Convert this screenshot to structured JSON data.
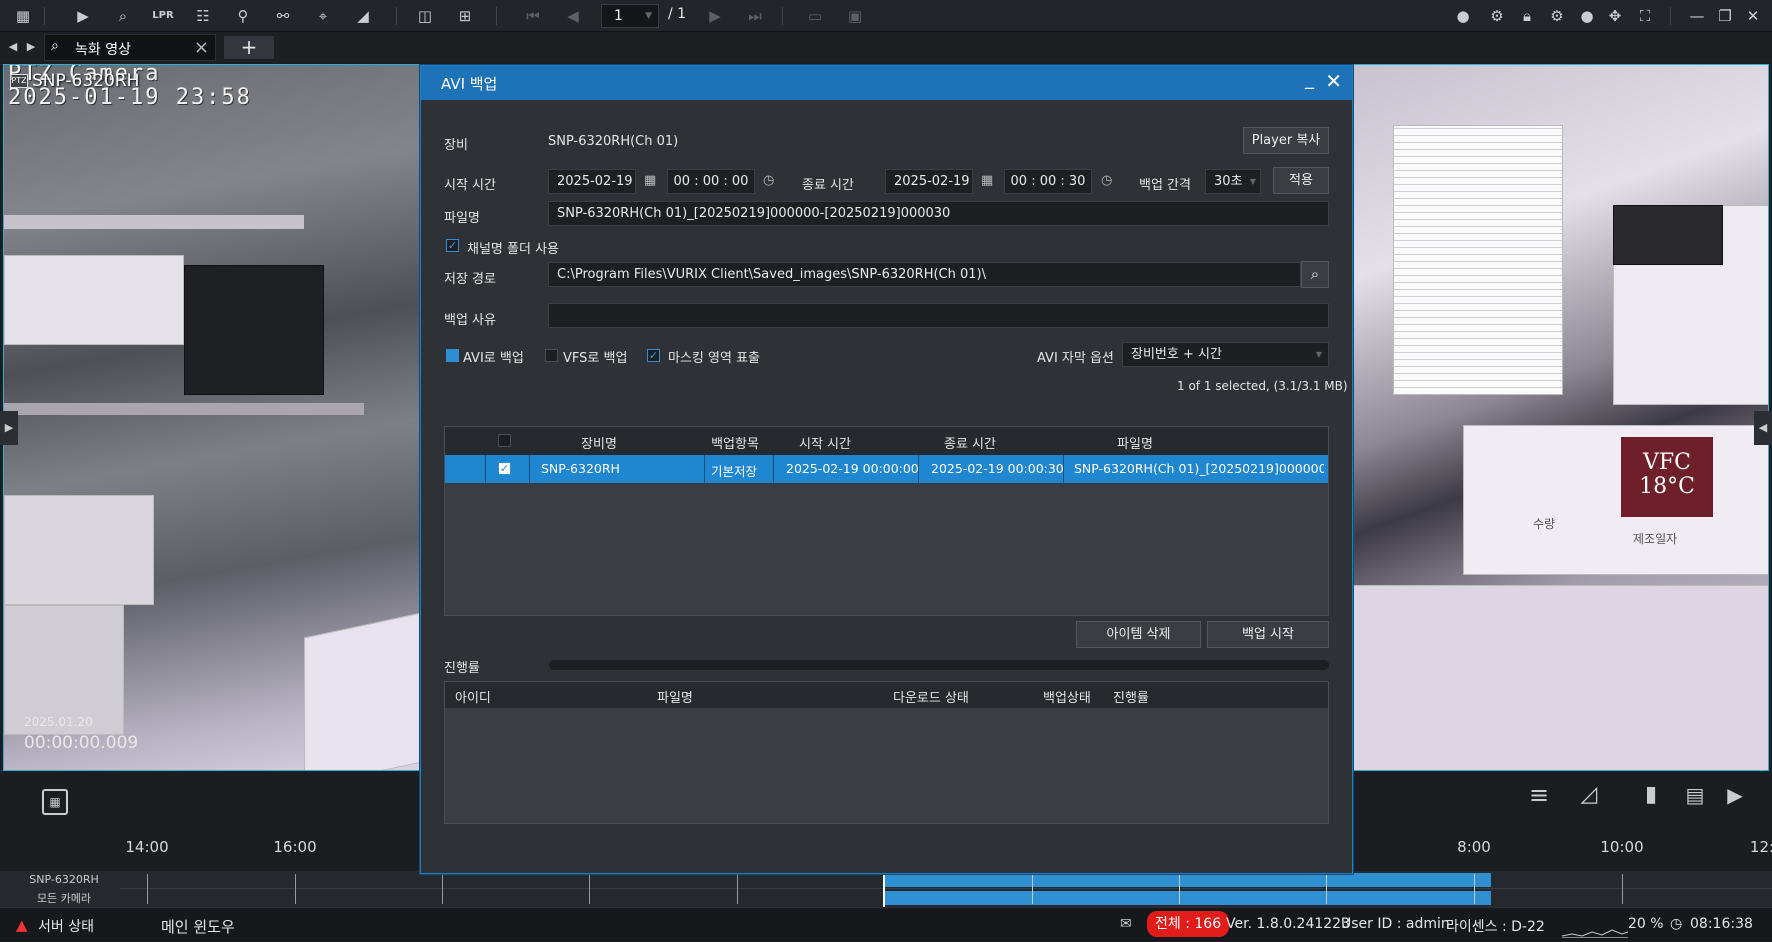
{
  "toolbar": {
    "page_current": "1",
    "page_total": "/ 1"
  },
  "tabs": [
    {
      "label": "녹화 영상"
    }
  ],
  "video_left": {
    "camera_name": "SNP-6320RH",
    "osd_line1": "PTZ Camera",
    "osd_line2": "2025-01-19  23:58",
    "date": "2025.01.20",
    "time": "00:00:00.009"
  },
  "video_right": {
    "box_text": "VFC 18°C",
    "label1": "수량",
    "label2": "제조일자"
  },
  "dialog": {
    "title": "AVI 백업",
    "device_label": "장비",
    "device_value": "SNP-6320RH(Ch 01)",
    "player_copy_button": "Player 복사",
    "start_time_label": "시작 시간",
    "start_date": "2025-02-19",
    "start_time": "00 : 00 : 00",
    "end_time_label": "종료 시간",
    "end_date": "2025-02-19",
    "end_time": "00 : 00 : 30",
    "interval_label": "백업 간격",
    "interval_value": "30초",
    "apply_button": "적용",
    "filename_label": "파일명",
    "filename_value": "SNP-6320RH(Ch 01)_[20250219]000000-[20250219]000030",
    "channel_folder_label": "채널명 폴더 사용",
    "save_path_label": "저장 경로",
    "save_path_value": "C:\\Program Files\\VURIX Client\\Saved_images\\SNP-6320RH(Ch 01)\\",
    "reason_label": "백업 사유",
    "reason_value": "",
    "avi_backup_label": "AVI로 백업",
    "vfs_backup_label": "VFS로 백업",
    "masking_label": "마스킹 영역 표출",
    "subtitle_option_label": "AVI 자막 옵션",
    "subtitle_option_value": "장비번호 + 시간",
    "selection_summary": "1 of 1 selected, (3.1/3.1 MB)",
    "columns": [
      "장비명",
      "백업항목",
      "시작 시간",
      "종료 시간",
      "파일명"
    ],
    "rows": [
      {
        "device": "SNP-6320RH",
        "item": "기본저장",
        "start": "2025-02-19 00:00:00",
        "end": "2025-02-19 00:00:30",
        "file": "SNP-6320RH(Ch 01)_[20250219]000000-[2..."
      }
    ],
    "delete_item_button": "아이템 삭제",
    "start_backup_button": "백업 시작",
    "progress_label": "진행률",
    "progress": 0,
    "job_columns": [
      "아이디",
      "파일명",
      "다운로드 상태",
      "백업상태",
      "진행률"
    ]
  },
  "timeline": {
    "hours": [
      "14:00",
      "16:00",
      "8:00",
      "10:00",
      "12:"
    ],
    "tracks": [
      "SNP-6320RH",
      "모든 카메라"
    ]
  },
  "statusbar": {
    "server_status": "서버 상태",
    "main_window": "메인 윈도우",
    "total": "전체 : 166",
    "version": "Ver. 1.8.0.241223",
    "user": "User ID : admin",
    "license": "라이센스 : D-22",
    "cpu": "20 %",
    "clock": "08:16:38"
  },
  "colors": {
    "accent": "#1e73b8",
    "selection": "#1f86d2",
    "alert": "#e21b1b",
    "recording": "#2f8fd3"
  }
}
